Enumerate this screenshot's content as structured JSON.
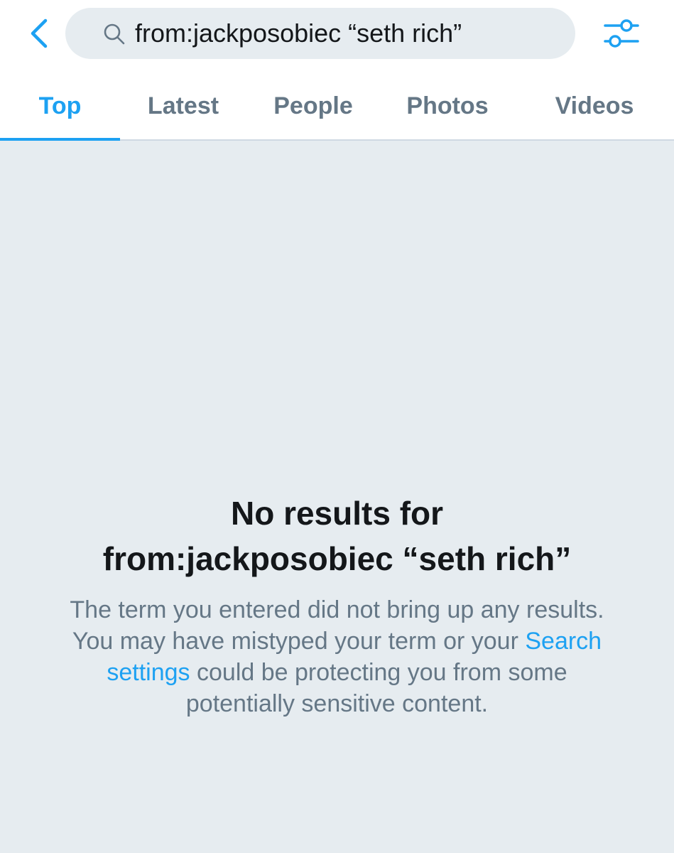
{
  "header": {
    "search": {
      "value": "from:jackposobiec “seth rich”",
      "placeholder": ""
    },
    "icons": {
      "back": "chevron-left-icon",
      "search": "search-icon",
      "filter": "sliders-icon"
    }
  },
  "tabs": [
    {
      "label": "Top",
      "active": true
    },
    {
      "label": "Latest",
      "active": false
    },
    {
      "label": "People",
      "active": false
    },
    {
      "label": "Photos",
      "active": false
    },
    {
      "label": "Videos",
      "active": false
    }
  ],
  "empty_state": {
    "title_line1": "No results for",
    "title_line2": "from:jackposobiec “seth rich”",
    "body_before_link": "The term you entered did not bring up any results. You may have mistyped your term or your ",
    "link_text": "Search settings",
    "body_after_link": " could be protecting you from some potentially sensitive content."
  },
  "colors": {
    "accent": "#1da1f2",
    "muted_text": "#657786",
    "primary_text": "#14171a",
    "background": "#e6ecf0"
  }
}
